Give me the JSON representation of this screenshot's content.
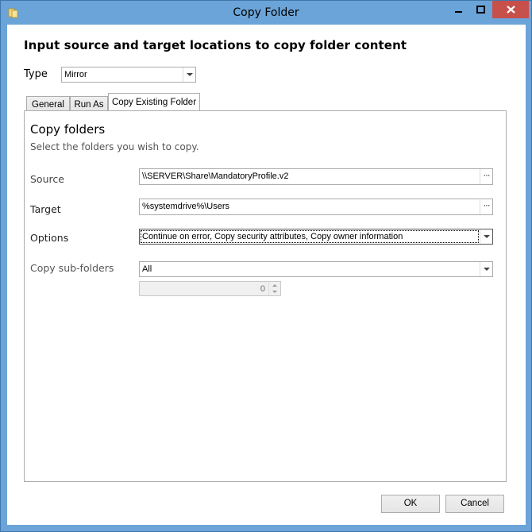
{
  "window": {
    "title": "Copy Folder",
    "icon": "folder-copy-icon",
    "accent_color": "#6ba4d8",
    "close_color": "#c7504b"
  },
  "heading": "Input source and target locations to copy folder content",
  "type_field": {
    "label": "Type",
    "value": "Mirror"
  },
  "tabs": [
    {
      "label": "General",
      "active": false
    },
    {
      "label": "Run As",
      "active": false
    },
    {
      "label": "Copy Existing Folder",
      "active": true
    }
  ],
  "panel": {
    "title": "Copy folders",
    "subtitle": "Select the folders you wish to copy.",
    "source": {
      "label": "Source",
      "value": "\\\\SERVER\\Share\\MandatoryProfile.v2",
      "browse": "···"
    },
    "target": {
      "label": "Target",
      "value": "%systemdrive%\\Users",
      "browse": "···"
    },
    "options": {
      "label": "Options",
      "value": "Continue on error, Copy security attributes, Copy owner information"
    },
    "subfolders": {
      "label": "Copy sub-folders",
      "value": "All",
      "depth_value": "0"
    }
  },
  "buttons": {
    "ok": "OK",
    "cancel": "Cancel"
  }
}
